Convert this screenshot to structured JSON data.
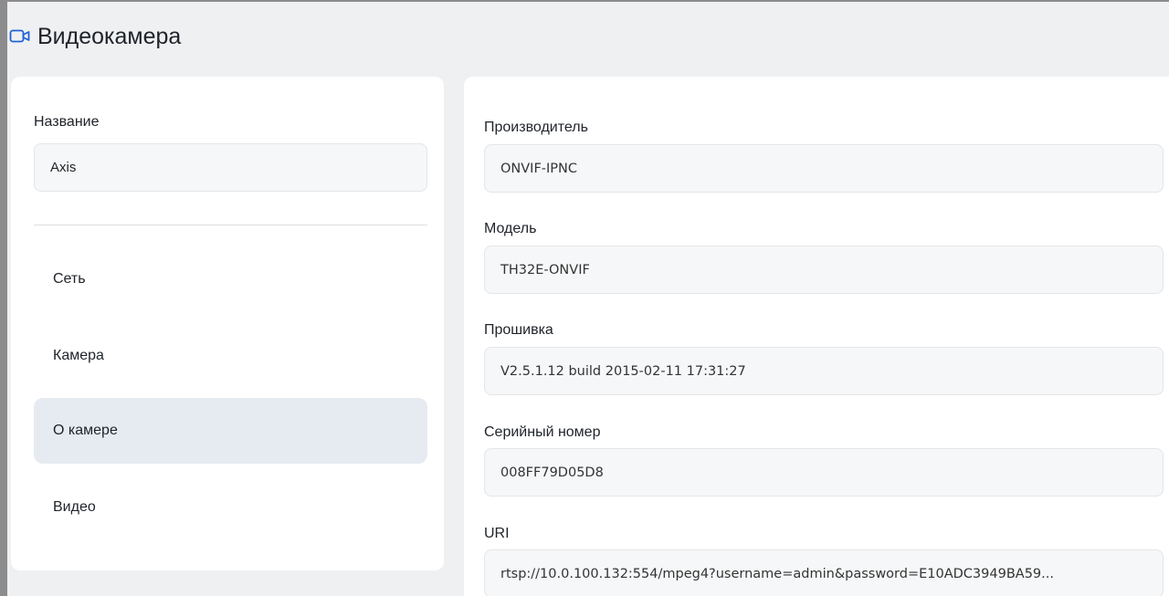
{
  "header": {
    "title": "Видеокамера",
    "icon": "video-camera-icon",
    "accent": "#1e63d6"
  },
  "left": {
    "name_label": "Название",
    "name_value": "Axis",
    "nav": [
      {
        "label": "Сеть",
        "active": false
      },
      {
        "label": "Камера",
        "active": false
      },
      {
        "label": "О камере",
        "active": true
      },
      {
        "label": "Видео",
        "active": false
      }
    ]
  },
  "info": {
    "manufacturer_label": "Производитель",
    "manufacturer_value": "ONVIF-IPNC",
    "model_label": "Модель",
    "model_value": "TH32E-ONVIF",
    "firmware_label": "Прошивка",
    "firmware_value": "V2.5.1.12 build 2015-02-11 17:31:27",
    "serial_label": "Серийный номер",
    "serial_value": "008FF79D05D8",
    "uri_label": "URI",
    "uri_value": "rtsp://10.0.100.132:554/mpeg4?username=admin&password=E10ADC3949BA59..."
  },
  "colors": {
    "background": "#eff0f2",
    "panel": "#ffffff",
    "active_nav": "#e6ebf1",
    "input_bg": "#f6f7f8"
  }
}
